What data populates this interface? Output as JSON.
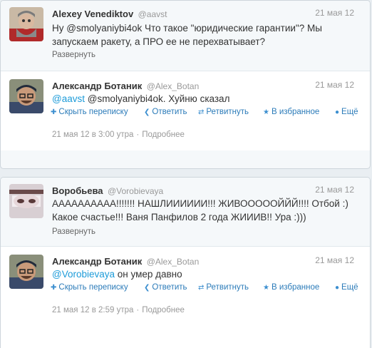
{
  "threads": [
    {
      "main": {
        "fullname": "Alexey Venediktov",
        "username": "@aavst",
        "time": "21 мая 12",
        "text": "Ну @smolyaniybi4ok Что такое \"юридические гарантии\"? Мы запускаем ракету, а ПРО ее не перехватывает?",
        "expand": "Развернуть"
      },
      "reply": {
        "fullname": "Александр Ботаник",
        "username": "@Alex_Botan",
        "time": "21 мая 12",
        "mention": "@aavst",
        "text": " @smolyaniybi4ok. Хуйню сказал",
        "actions": {
          "hide": "Скрыть переписку",
          "reply": "Ответить",
          "retweet": "Ретвитнуть",
          "favorite": "В избранное",
          "more": "Ещё"
        },
        "timestamp": "21 мая 12 в 3:00 утра",
        "details": "Подробнее"
      }
    },
    {
      "main": {
        "fullname": "Воробьева",
        "username": "@Vorobievaya",
        "time": "21 мая 12",
        "text": "АААААААААА!!!!!!! НАШЛИИИИИИ!!! ЖИВООООOЙЙЙ!!!! Отбой :) Какое счастье!!! Ваня Панфилов 2 года ЖИИИВ!! Ура :)))",
        "expand": "Развернуть"
      },
      "reply": {
        "fullname": "Александр Ботаник",
        "username": "@Alex_Botan",
        "time": "21 мая 12",
        "mention": "@Vorobievaya",
        "text": " он умер давно",
        "actions": {
          "hide": "Скрыть переписку",
          "reply": "Ответить",
          "retweet": "Ретвитнуть",
          "favorite": "В избранное",
          "more": "Ещё"
        },
        "timestamp": "21 мая 12 в 2:59 утра",
        "details": "Подробнее"
      }
    }
  ],
  "icons": {
    "hide": "arrows-collapse-icon",
    "reply": "reply-arrow-icon",
    "retweet": "retweet-icon",
    "favorite": "star-icon",
    "more": "dots-icon"
  },
  "colors": {
    "link": "#2b7bb9",
    "mention": "#1c9bd9",
    "meta": "#999999",
    "panel": "#f5f8fa"
  }
}
